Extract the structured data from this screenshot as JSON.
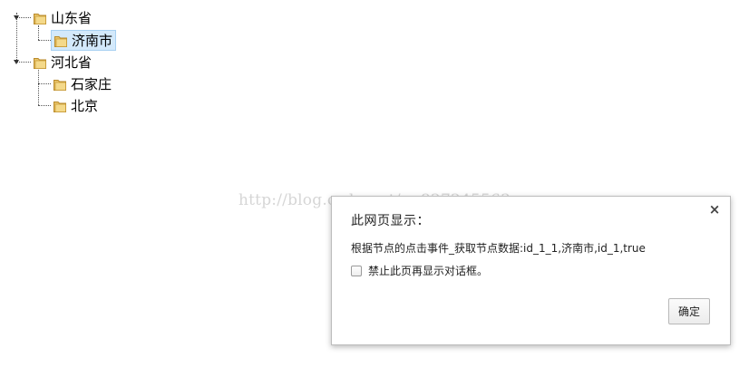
{
  "tree": {
    "nodes": [
      {
        "label": "山东省",
        "children": [
          {
            "label": "济南市",
            "selected": true
          }
        ]
      },
      {
        "label": "河北省",
        "children": [
          {
            "label": "石家庄"
          },
          {
            "label": "北京"
          }
        ]
      }
    ],
    "selection_color": "#d3e9fb",
    "folder_icon": "folder-icon"
  },
  "watermark": {
    "text": "http://blog.csdn.net/qq827245563"
  },
  "dialog": {
    "title": "此网页显示：",
    "message": "根据节点的点击事件_获取节点数据:id_1_1,济南市,id_1,true",
    "suppress_label": "禁止此页再显示对话框。",
    "suppress_checked": false,
    "ok_label": "确定",
    "close_glyph": "×"
  }
}
